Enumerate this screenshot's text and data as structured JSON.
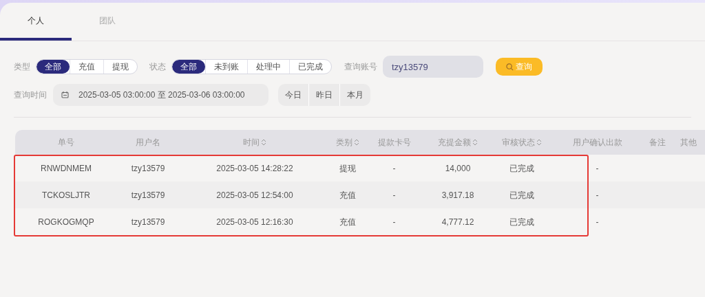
{
  "tabs": [
    {
      "label": "个人",
      "selected": true
    },
    {
      "label": "团队",
      "selected": false
    }
  ],
  "filters": {
    "type": {
      "label": "类型",
      "options": [
        {
          "label": "全部",
          "selected": true
        },
        {
          "label": "充值",
          "selected": false
        },
        {
          "label": "提现",
          "selected": false
        }
      ]
    },
    "status": {
      "label": "状态",
      "options": [
        {
          "label": "全部",
          "selected": true
        },
        {
          "label": "未到账",
          "selected": false
        },
        {
          "label": "处理中",
          "selected": false
        },
        {
          "label": "已完成",
          "selected": false
        }
      ]
    },
    "account": {
      "label": "查询账号",
      "value": "tzy13579"
    },
    "search_button": "查询",
    "time": {
      "label": "查询时间",
      "value": "2025-03-05 03:00:00 至 2025-03-06 03:00:00"
    },
    "quick_ranges": [
      "今日",
      "昨日",
      "本月"
    ]
  },
  "table": {
    "columns": [
      {
        "label": "单号",
        "sortable": false
      },
      {
        "label": "用户名",
        "sortable": false
      },
      {
        "label": "时间",
        "sortable": true
      },
      {
        "label": "类别",
        "sortable": true
      },
      {
        "label": "提款卡号",
        "sortable": false
      },
      {
        "label": "充提金额",
        "sortable": true
      },
      {
        "label": "审核状态",
        "sortable": true
      },
      {
        "label": "用户确认出款",
        "sortable": false
      },
      {
        "label": "备注",
        "sortable": false
      },
      {
        "label": "其他",
        "sortable": false
      }
    ],
    "rows": [
      [
        "RNWDNMEM",
        "tzy13579",
        "2025-03-05 14:28:22",
        "提现",
        "-",
        "14,000",
        "已完成",
        "-"
      ],
      [
        "TCKOSLJTR",
        "tzy13579",
        "2025-03-05 12:54:00",
        "充值",
        "-",
        "3,917.18",
        "已完成",
        "-"
      ],
      [
        "ROGKOGMQP",
        "tzy13579",
        "2025-03-05 12:16:30",
        "充值",
        "-",
        "4,777.12",
        "已完成",
        "-"
      ]
    ]
  }
}
